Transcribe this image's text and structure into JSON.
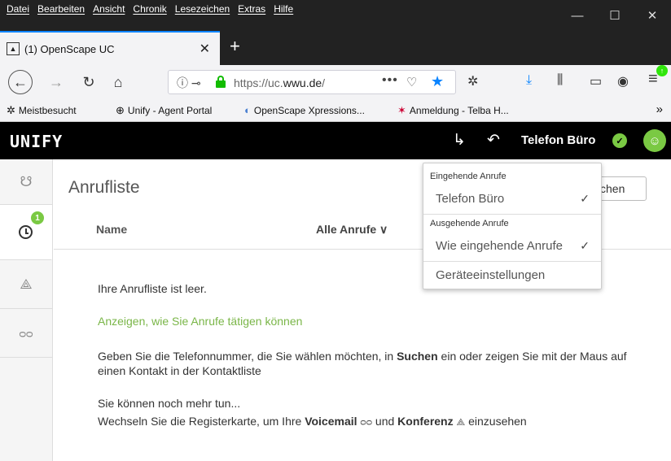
{
  "menubar": {
    "items": [
      "Datei",
      "Bearbeiten",
      "Ansicht",
      "Chronik",
      "Lesezeichen",
      "Extras",
      "Hilfe"
    ],
    "minimize": "—",
    "maximize": "☐",
    "close": "✕"
  },
  "tab": {
    "title": "(1) OpenScape UC",
    "close": "✕",
    "new_tab": "+"
  },
  "navbar": {
    "url_prefix": "https://uc.",
    "url_domain": "wwu.de",
    "url_suffix": "/",
    "more": "•••"
  },
  "bookmarks": [
    {
      "label": "Meistbesucht",
      "icon": "gear-icon"
    },
    {
      "label": "Unify - Agent Portal",
      "icon": "globe-icon"
    },
    {
      "label": "OpenScape Xpressions...",
      "icon": "bookmark-icon"
    },
    {
      "label": "Anmeldung - Telba H...",
      "icon": "star-icon"
    }
  ],
  "unify": {
    "logo": "UNIFY",
    "device": "Telefon Büro",
    "rail_badge": "1"
  },
  "main": {
    "page_title": "Anrufliste",
    "search_button": "chen",
    "column_name": "Name",
    "filter_label": "Alle Anrufe",
    "empty_text": "Ihre Anrufliste ist leer.",
    "how_link": "Anzeigen, wie Sie Anrufe tätigen können",
    "para1_a": "Geben Sie die Telefonnummer, die Sie wählen möchten, in ",
    "para1_bold": "Suchen",
    "para1_b": " ein oder zeigen Sie mit der Maus auf einen Kontakt in der Kontaktliste",
    "para2": "Sie können noch mehr tun...",
    "para3_a": "Wechseln Sie die Registerkarte, um Ihre ",
    "para3_voicemail": "Voicemail",
    "para3_mid": " und ",
    "para3_konferenz": "Konferenz",
    "para3_end": " einzusehen"
  },
  "dropdown": {
    "incoming_header": "Eingehende Anrufe",
    "incoming_item": "Telefon Büro",
    "outgoing_header": "Ausgehende Anrufe",
    "outgoing_item": "Wie eingehende Anrufe",
    "settings_item": "Geräteeinstellungen",
    "check": "✓"
  },
  "colors": {
    "accent_green": "#7ac943",
    "link_green": "#7ab648",
    "firefox_blue": "#0a84ff"
  }
}
